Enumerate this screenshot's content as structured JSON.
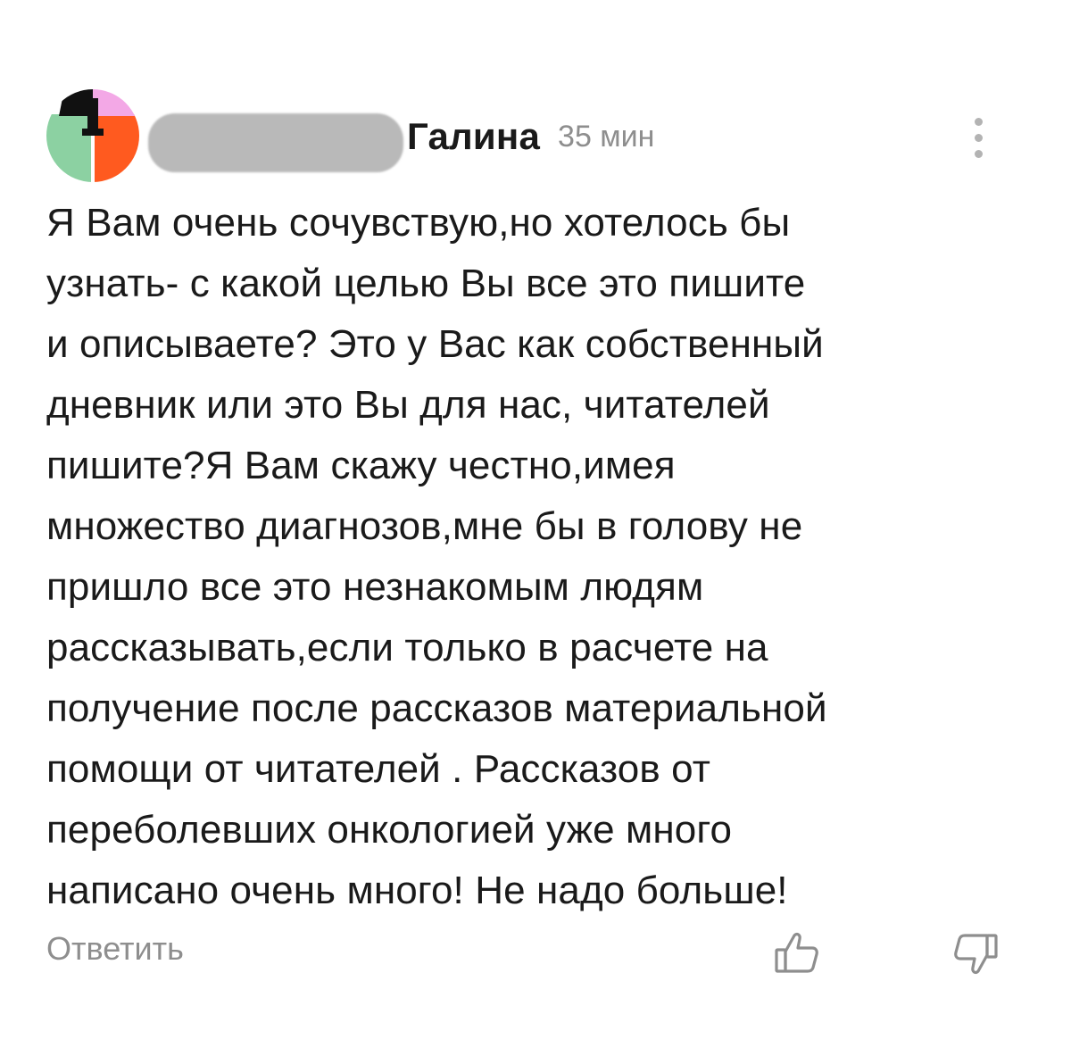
{
  "comment": {
    "author_name": "Галина",
    "timestamp": "35 мин",
    "avatar_colors": {
      "green": "#8cd1a2",
      "orange": "#ff5a1f",
      "pink": "#f3a8e6",
      "black": "#111111"
    },
    "body": "Я Вам очень сочувствую,но хотелось бы\nузнать- с какой целью Вы все это пишите\nи описываете? Это у Вас как собственный\nдневник или это Вы для нас, читателей\nпишите?Я Вам скажу честно,имея\nмножество диагнозов,мне бы в голову не\nпришло все это незнакомым людям\nрассказывать,если только в расчете на\nполучение после рассказов материальной\nпомощи от читателей . Рассказов от\nпереболевших онкологией уже много\nнаписано очень много! Не надо больше!",
    "reply_label": "Ответить",
    "icons": {
      "more": "more-vertical-icon",
      "like": "thumbs-up-icon",
      "dislike": "thumbs-down-icon"
    },
    "muted_color": "#8e8e8e"
  }
}
